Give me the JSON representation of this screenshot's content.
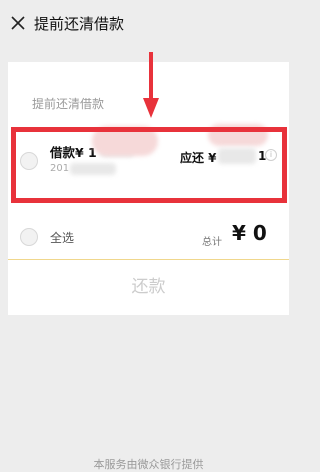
{
  "header": {
    "close_icon": "close-icon",
    "title": "提前还清借款"
  },
  "card": {
    "section_title": "提前还清借款",
    "loan": {
      "name_prefix": "借款¥ 1",
      "date_prefix": "201",
      "due_prefix": "应还 ¥",
      "due_suffix": "1"
    },
    "select_all": {
      "label": "全选",
      "total_label": "总计",
      "total_value": "¥ 0"
    },
    "repay_button": "还款"
  },
  "footer": {
    "text": "本服务由微众银行提供"
  },
  "colors": {
    "highlight": "#e8323b",
    "accent_line": "#f0d78c",
    "background": "#ededed"
  }
}
